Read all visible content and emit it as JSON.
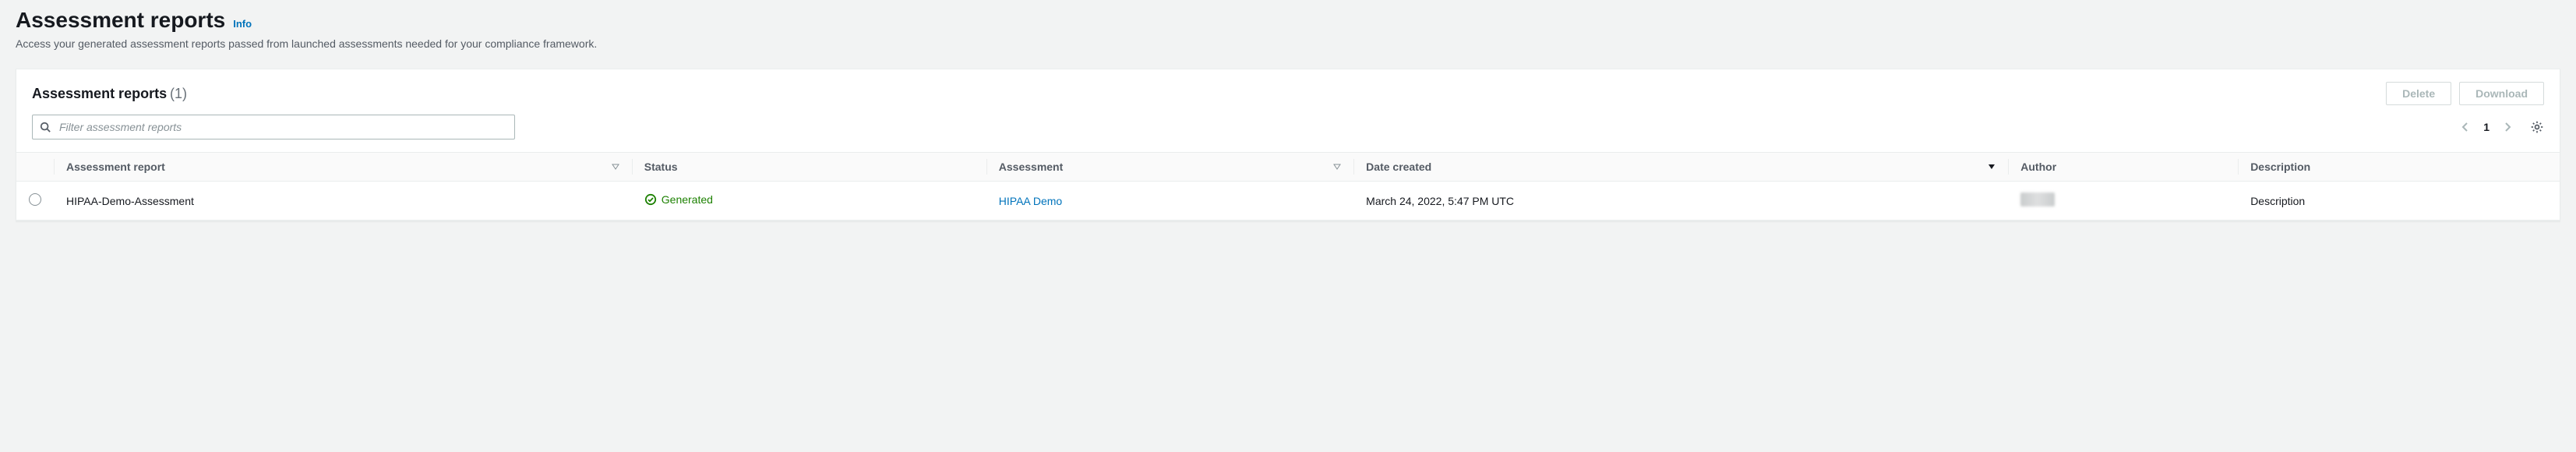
{
  "header": {
    "title": "Assessment reports",
    "info": "Info",
    "subtitle": "Access your generated assessment reports passed from launched assessments needed for your compliance framework."
  },
  "panel": {
    "title": "Assessment reports",
    "count": "(1)",
    "actions": {
      "delete": "Delete",
      "download": "Download"
    },
    "search": {
      "placeholder": "Filter assessment reports"
    },
    "pager": {
      "page": "1"
    }
  },
  "columns": {
    "report": "Assessment report",
    "status": "Status",
    "assessment": "Assessment",
    "date_created": "Date created",
    "author": "Author",
    "description": "Description"
  },
  "rows": [
    {
      "report": "HIPAA-Demo-Assessment",
      "status": "Generated",
      "assessment": "HIPAA Demo",
      "date_created": "March 24, 2022, 5:47 PM UTC",
      "author": "",
      "description": "Description"
    }
  ]
}
